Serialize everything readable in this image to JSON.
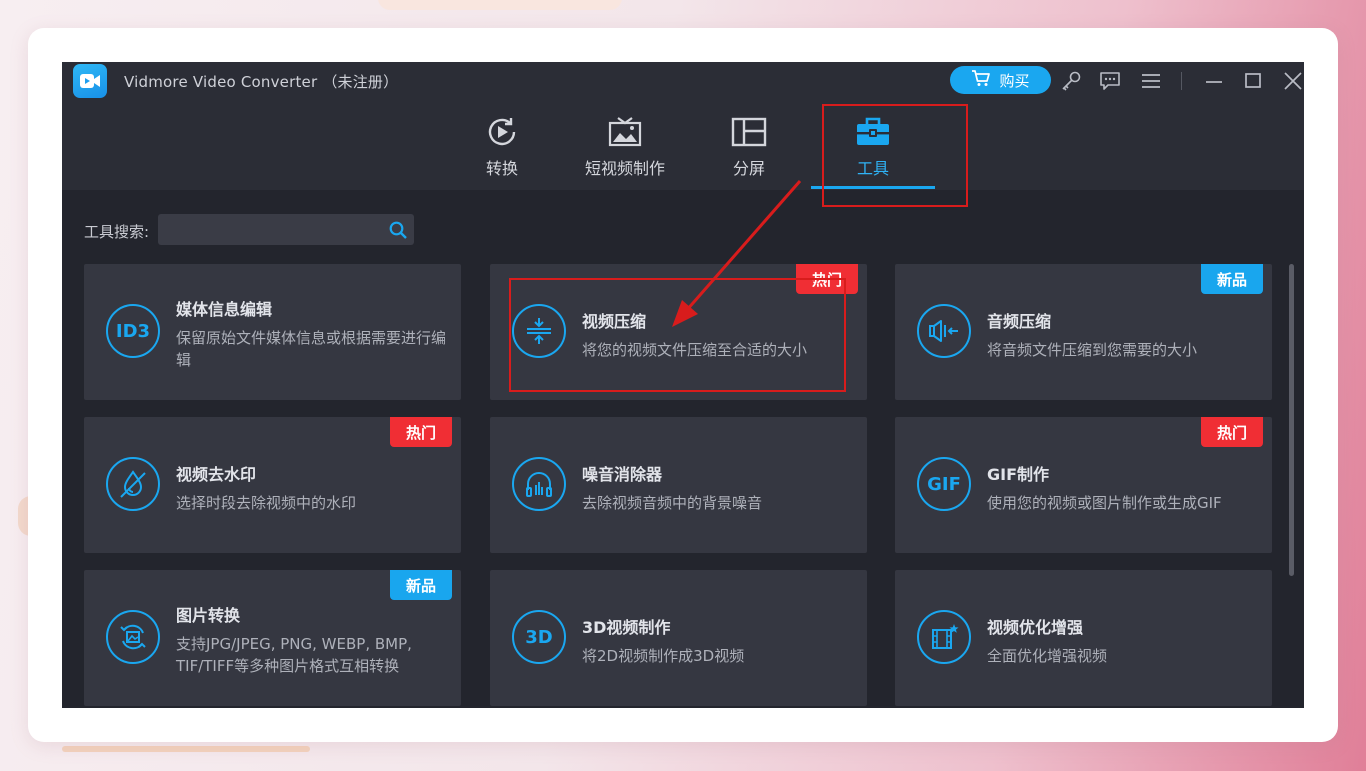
{
  "window": {
    "title": "Vidmore Video Converter （未注册）",
    "buy_label": "购买",
    "icons": [
      "key-icon",
      "feedback-icon",
      "menu-icon",
      "minimize-icon",
      "maximize-icon",
      "close-icon"
    ]
  },
  "nav": {
    "tabs": [
      {
        "label": "转换",
        "icon": "convert-icon",
        "active": false
      },
      {
        "label": "短视频制作",
        "icon": "mv-icon",
        "active": false
      },
      {
        "label": "分屏",
        "icon": "collage-icon",
        "active": false
      },
      {
        "label": "工具",
        "icon": "toolbox-icon",
        "active": true
      }
    ]
  },
  "search": {
    "label": "工具搜索:",
    "placeholder": "",
    "value": ""
  },
  "tools": [
    {
      "title": "媒体信息编辑",
      "desc": "保留原始文件媒体信息或根据需要进行编辑",
      "icon_text": "ID3",
      "badge": "",
      "icon": "id3-icon"
    },
    {
      "title": "视频压缩",
      "desc": "将您的视频文件压缩至合适的大小",
      "icon_text": "",
      "badge": "热门",
      "icon": "compress-icon"
    },
    {
      "title": "音频压缩",
      "desc": "将音频文件压缩到您需要的大小",
      "icon_text": "",
      "badge": "新品",
      "icon": "audio-compress-icon"
    },
    {
      "title": "视频去水印",
      "desc": "选择时段去除视频中的水印",
      "icon_text": "",
      "badge": "热门",
      "icon": "watermark-remove-icon"
    },
    {
      "title": "噪音消除器",
      "desc": "去除视频音频中的背景噪音",
      "icon_text": "",
      "badge": "",
      "icon": "noise-remover-icon"
    },
    {
      "title": "GIF制作",
      "desc": "使用您的视频或图片制作或生成GIF",
      "icon_text": "GIF",
      "badge": "热门",
      "icon": "gif-icon"
    },
    {
      "title": "图片转换",
      "desc": "支持JPG/JPEG, PNG, WEBP, BMP, TIF/TIFF等多种图片格式互相转换",
      "icon_text": "",
      "badge": "新品",
      "icon": "image-convert-icon"
    },
    {
      "title": "3D视频制作",
      "desc": "将2D视频制作成3D视频",
      "icon_text": "3D",
      "badge": "",
      "icon": "3d-icon"
    },
    {
      "title": "视频优化增强",
      "desc": "全面优化增强视频",
      "icon_text": "",
      "badge": "",
      "icon": "video-enhance-icon"
    }
  ],
  "colors": {
    "accent": "#1aa7f0",
    "hot_badge": "#f02e34",
    "new_badge": "#19a6ee",
    "highlight": "#d81c1c",
    "bg": "#23252d",
    "card": "#353741"
  }
}
